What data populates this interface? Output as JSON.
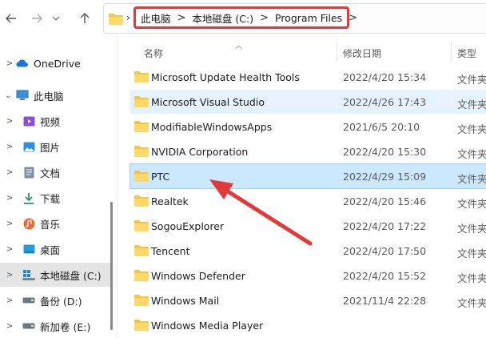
{
  "nav": {
    "back_icon": "arrow-left-icon",
    "forward_icon": "arrow-right-icon",
    "dropdown_icon": "chevron-down-icon",
    "up_icon": "arrow-up-icon"
  },
  "breadcrumb": {
    "items": [
      "此电脑",
      "本地磁盘 (C:)",
      "Program Files"
    ],
    "separator": ">"
  },
  "sidebar": {
    "items": [
      {
        "label": "OneDrive",
        "icon": "cloud-icon"
      },
      {
        "label": "此电脑",
        "icon": "computer-icon"
      },
      {
        "label": "视频",
        "icon": "video-icon"
      },
      {
        "label": "图片",
        "icon": "image-icon"
      },
      {
        "label": "文档",
        "icon": "document-icon"
      },
      {
        "label": "下载",
        "icon": "download-icon"
      },
      {
        "label": "音乐",
        "icon": "music-icon"
      },
      {
        "label": "桌面",
        "icon": "desktop-icon"
      },
      {
        "label": "本地磁盘 (C:)",
        "icon": "windows-drive-icon"
      },
      {
        "label": "备份 (D:)",
        "icon": "drive-icon"
      },
      {
        "label": "新加卷 (E:)",
        "icon": "drive-icon"
      }
    ]
  },
  "columns": {
    "name": "名称",
    "date": "修改日期",
    "type": "类型"
  },
  "files": [
    {
      "name": "Microsoft Update Health Tools",
      "date": "2022/4/20 15:34",
      "type": "文件夹"
    },
    {
      "name": "Microsoft Visual Studio",
      "date": "2022/4/26 17:43",
      "type": "文件夹"
    },
    {
      "name": "ModifiableWindowsApps",
      "date": "2021/6/5 20:10",
      "type": "文件夹"
    },
    {
      "name": "NVIDIA Corporation",
      "date": "2022/4/20 15:30",
      "type": "文件夹"
    },
    {
      "name": "PTC",
      "date": "2022/4/29 15:09",
      "type": "文件夹"
    },
    {
      "name": "Realtek",
      "date": "2022/4/20 15:46",
      "type": "文件夹"
    },
    {
      "name": "SogouExplorer",
      "date": "2022/4/20 17:22",
      "type": "文件夹"
    },
    {
      "name": "Tencent",
      "date": "2022/4/20 17:50",
      "type": "文件夹"
    },
    {
      "name": "Windows Defender",
      "date": "2022/4/20 15:52",
      "type": "文件夹"
    },
    {
      "name": "Windows Mail",
      "date": "2021/11/4 22:28",
      "type": "文件夹"
    },
    {
      "name": "Windows Media Player",
      "date": "",
      "type": ""
    }
  ],
  "colors": {
    "annotation_red": "#e23a3a",
    "selected_row": "#cce8ff",
    "hover_row": "#e5f3ff",
    "folder": "#f6c547"
  }
}
